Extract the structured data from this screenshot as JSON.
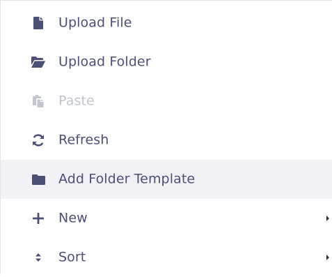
{
  "colors": {
    "icon": "#4b5076",
    "icon_disabled": "#c3c5cf",
    "label": "#4b5076",
    "label_disabled": "#c3c5cf",
    "hover_background": "#f1f1f6"
  },
  "menu": {
    "items": [
      {
        "label": "Upload File",
        "icon": "file-icon",
        "disabled": false,
        "hovered": false,
        "has_submenu": false
      },
      {
        "label": "Upload Folder",
        "icon": "folder-open-icon",
        "disabled": false,
        "hovered": false,
        "has_submenu": false
      },
      {
        "label": "Paste",
        "icon": "paste-icon",
        "disabled": true,
        "hovered": false,
        "has_submenu": false
      },
      {
        "label": "Refresh",
        "icon": "refresh-icon",
        "disabled": false,
        "hovered": false,
        "has_submenu": false
      },
      {
        "label": "Add Folder Template",
        "icon": "folder-icon",
        "disabled": false,
        "hovered": true,
        "has_submenu": false
      },
      {
        "label": "New",
        "icon": "plus-icon",
        "disabled": false,
        "hovered": false,
        "has_submenu": true
      },
      {
        "label": "Sort",
        "icon": "sort-icon",
        "disabled": false,
        "hovered": false,
        "has_submenu": true
      }
    ]
  }
}
